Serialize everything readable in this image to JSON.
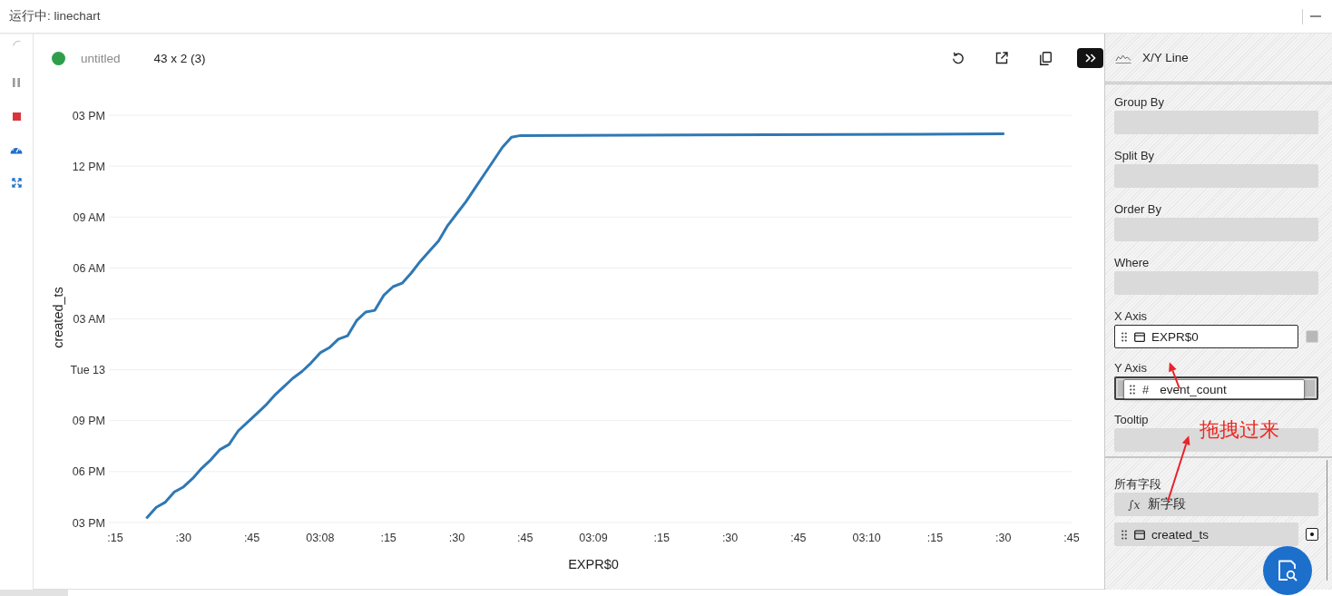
{
  "window": {
    "title": "运行中: linechart"
  },
  "toolbar": {
    "name": "untitled",
    "dimensions": "43 x 2 (3)"
  },
  "chart": {
    "xlabel": "EXPR$0",
    "ylabel": "created_ts",
    "xticks": [
      ":15",
      ":30",
      ":45",
      "03:08",
      ":15",
      ":30",
      ":45",
      "03:09",
      ":15",
      ":30",
      ":45",
      "03:10",
      ":15",
      ":30",
      ":45"
    ],
    "yticks": [
      "03 PM",
      "12 PM",
      "09 AM",
      "06 AM",
      "03 AM",
      "Tue 13",
      "09 PM",
      "06 PM",
      "03 PM"
    ]
  },
  "panel": {
    "chart_type": "X/Y Line",
    "filters": [
      {
        "label": "Group By"
      },
      {
        "label": "Split By"
      },
      {
        "label": "Order By"
      },
      {
        "label": "Where"
      }
    ],
    "axes": [
      {
        "label": "X Axis",
        "field": {
          "kind": "datetime",
          "name": "EXPR$0",
          "toggle_on": false
        }
      },
      {
        "label": "Y Axis",
        "highlighted": true,
        "drag_preview": {
          "kind": "numeric",
          "symbol": "#",
          "name": "event_count"
        }
      },
      {
        "label": "Tooltip",
        "highlighted": false
      }
    ],
    "all_fields": {
      "label": "所有字段",
      "items": [
        {
          "kind": "expression",
          "symbol": "∫x",
          "name": "新字段"
        },
        {
          "kind": "datetime",
          "name": "created_ts",
          "toggle_on": true
        }
      ]
    }
  },
  "annotation": {
    "text": "拖拽过来"
  }
}
